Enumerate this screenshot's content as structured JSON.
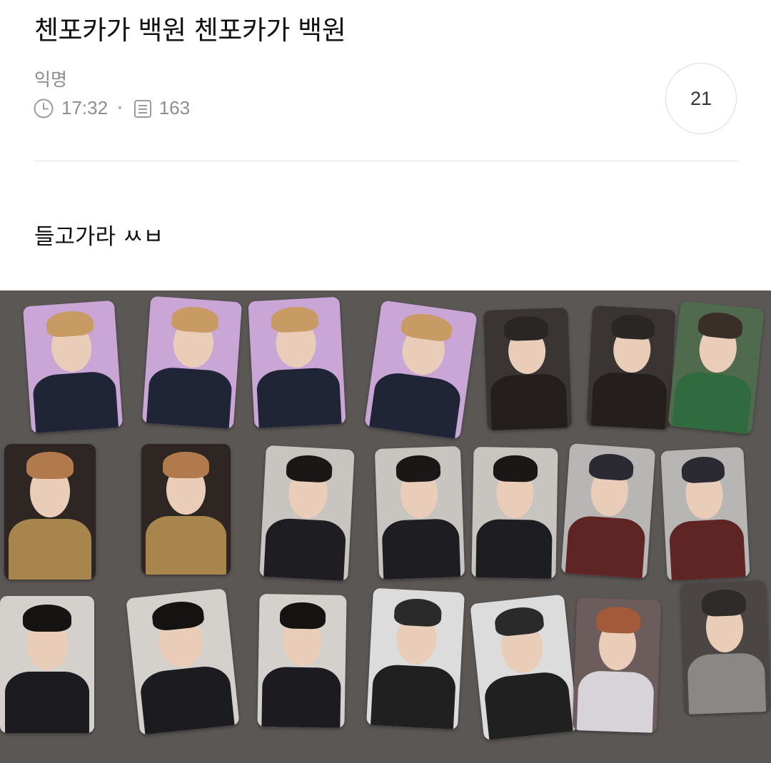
{
  "post": {
    "title": "첸포카가 백원 첸포카가 백원",
    "author": "익명",
    "time": "17:32",
    "views": "163",
    "comment_count": "21",
    "body": "들고가라 ㅆㅂ"
  },
  "icons": {
    "time": "clock-icon",
    "views": "document-icon"
  },
  "colors": {
    "meta_text": "#8e8e8e",
    "divider": "#e3e3e3",
    "photo_background": "#5a5755"
  }
}
